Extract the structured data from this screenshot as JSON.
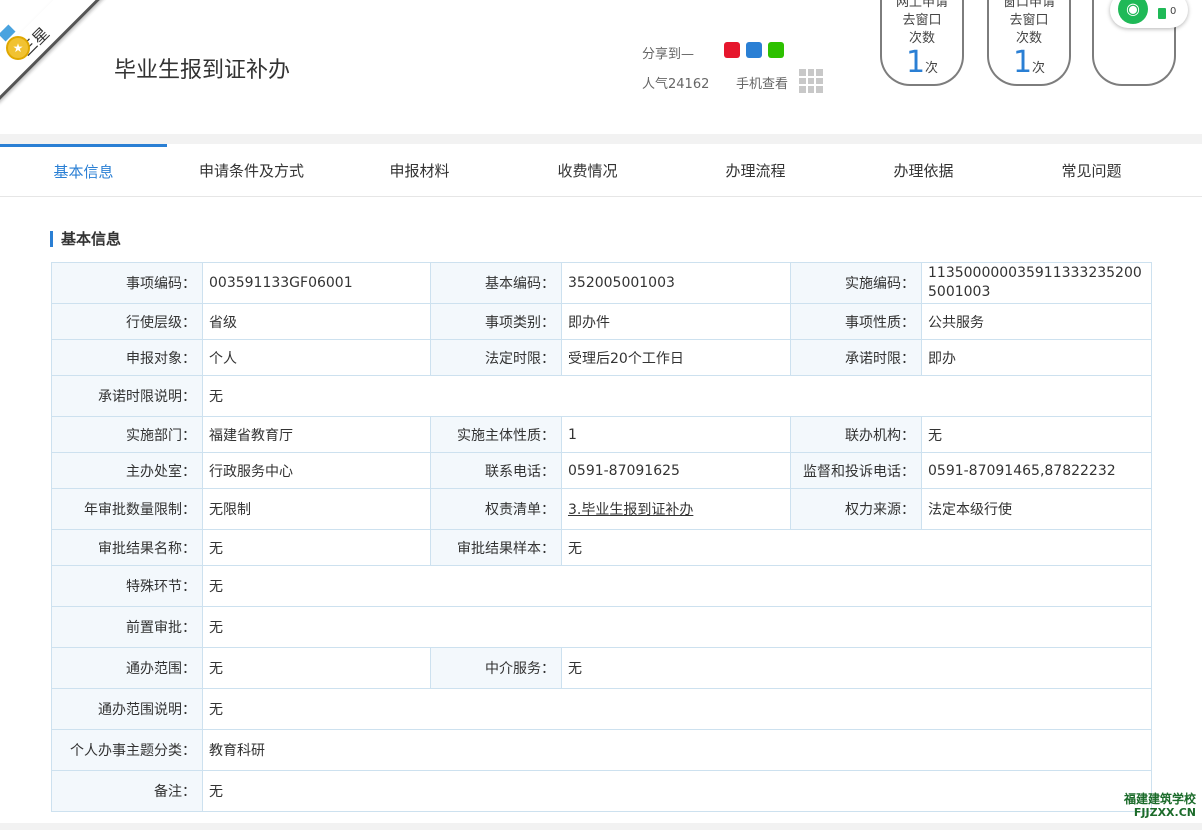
{
  "header": {
    "level_badge": "三星",
    "title": "毕业生报到证补办",
    "share_label": "分享到—",
    "views": "人气24162",
    "mobile_view": "手机查看"
  },
  "stats": [
    {
      "line1": "网上申请",
      "line2": "去窗口",
      "line3": "次数",
      "count": "1",
      "unit": "次"
    },
    {
      "line1": "窗口申请",
      "line2": "去窗口",
      "line3": "次数",
      "count": "1",
      "unit": "次"
    }
  ],
  "floating": {
    "count": "0"
  },
  "colors": {
    "accent": "#2a7fd4",
    "border": "#cde1ef",
    "label_bg": "#f3f8fc"
  },
  "tabs": [
    {
      "label": "基本信息",
      "active": true
    },
    {
      "label": "申请条件及方式"
    },
    {
      "label": "申报材料"
    },
    {
      "label": "收费情况"
    },
    {
      "label": "办理流程"
    },
    {
      "label": "办理依据"
    },
    {
      "label": "常见问题"
    }
  ],
  "section_title": "基本信息",
  "table": {
    "item_code_label": "事项编码：",
    "item_code": "003591133GF06001",
    "basic_code_label": "基本编码：",
    "basic_code": "352005001003",
    "impl_code_label": "实施编码：",
    "impl_code": "113500000035911333235200 5001003",
    "level_label": "行使层级：",
    "level": "省级",
    "category_label": "事项类别：",
    "category": "即办件",
    "nature_label": "事项性质：",
    "nature": "公共服务",
    "target_label": "申报对象：",
    "target": "个人",
    "legal_limit_label": "法定时限：",
    "legal_limit": "受理后20个工作日",
    "promise_limit_label": "承诺时限：",
    "promise_limit": "即办",
    "promise_note_label": "承诺时限说明：",
    "promise_note": "无",
    "dept_label": "实施部门：",
    "dept": "福建省教育厅",
    "subject_nature_label": "实施主体性质：",
    "subject_nature": "1",
    "joint_label": "联办机构：",
    "joint": "无",
    "office_label": "主办处室：",
    "office": "行政服务中心",
    "phone_label": "联系电话：",
    "phone": "0591-87091625",
    "complaint_label": "监督和投诉电话：",
    "complaint": "0591-87091465,87822232",
    "annual_limit_label": "年审批数量限制：",
    "annual_limit": "无限制",
    "power_list_label": "权责清单：",
    "power_list": "3.毕业生报到证补办",
    "power_source_label": "权力来源：",
    "power_source": "法定本级行使",
    "result_name_label": "审批结果名称：",
    "result_name": "无",
    "result_sample_label": "审批结果样本：",
    "result_sample": "无",
    "special_label": "特殊环节：",
    "special": "无",
    "pre_approval_label": "前置审批：",
    "pre_approval": "无",
    "scope_label": "通办范围：",
    "scope": "无",
    "agency_label": "中介服务：",
    "agency": "无",
    "scope_note_label": "通办范围说明：",
    "scope_note": "无",
    "theme_label": "个人办事主题分类：",
    "theme": "教育科研",
    "remark_label": "备注：",
    "remark": "无"
  },
  "watermark": {
    "cn": "福建建筑学校",
    "en": "FJJZXX.CN"
  }
}
